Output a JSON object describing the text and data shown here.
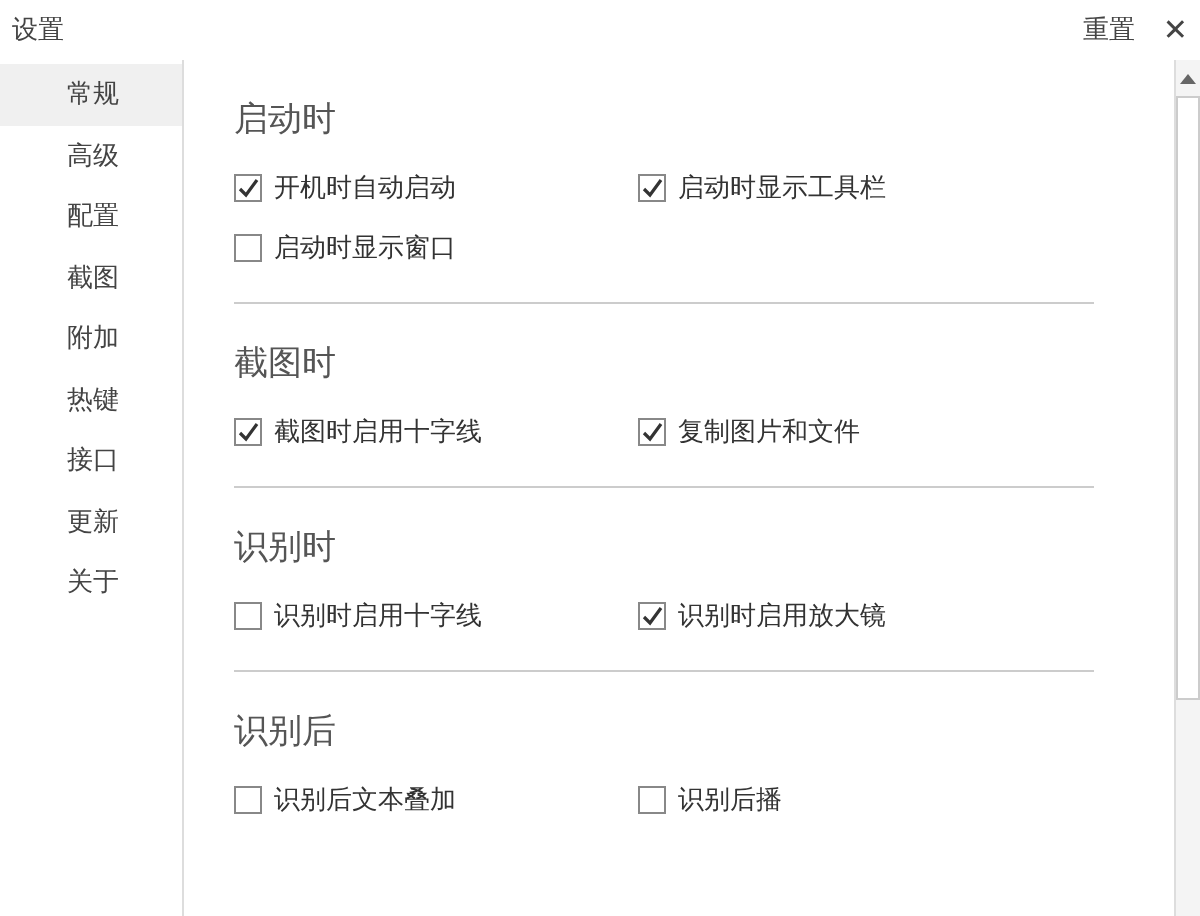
{
  "window": {
    "title": "设置",
    "reset": "重置",
    "close": "✕"
  },
  "sidebar": {
    "items": [
      {
        "label": "常规",
        "selected": true
      },
      {
        "label": "高级",
        "selected": false
      },
      {
        "label": "配置",
        "selected": false
      },
      {
        "label": "截图",
        "selected": false
      },
      {
        "label": "附加",
        "selected": false
      },
      {
        "label": "热键",
        "selected": false
      },
      {
        "label": "接口",
        "selected": false
      },
      {
        "label": "更新",
        "selected": false
      },
      {
        "label": "关于",
        "selected": false
      }
    ]
  },
  "sections": [
    {
      "title": "启动时",
      "options": [
        {
          "label": "开机时自动启动",
          "checked": true
        },
        {
          "label": "启动时显示工具栏",
          "checked": true
        },
        {
          "label": "启动时显示窗口",
          "checked": false
        }
      ]
    },
    {
      "title": "截图时",
      "options": [
        {
          "label": "截图时启用十字线",
          "checked": true
        },
        {
          "label": "复制图片和文件",
          "checked": true
        }
      ]
    },
    {
      "title": "识别时",
      "options": [
        {
          "label": "识别时启用十字线",
          "checked": false
        },
        {
          "label": "识别时启用放大镜",
          "checked": true
        }
      ]
    },
    {
      "title": "识别后",
      "options": [
        {
          "label": "识别后文本叠加",
          "checked": false
        },
        {
          "label": "识别后播",
          "checked": false
        }
      ]
    }
  ]
}
